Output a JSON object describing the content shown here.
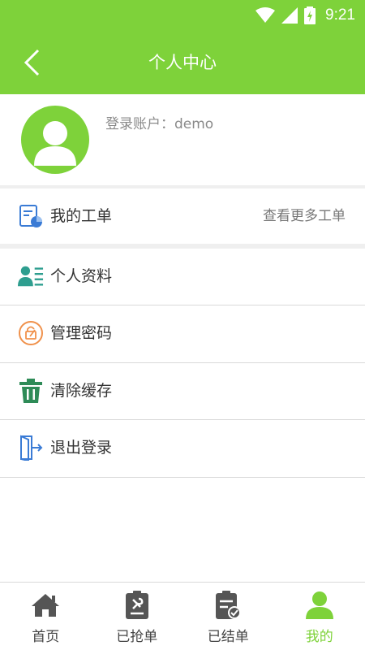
{
  "status_bar": {
    "time": "9:21"
  },
  "app_bar": {
    "title": "个人中心"
  },
  "profile": {
    "account_text": "登录账户：demo"
  },
  "work_orders": {
    "label": "我的工单",
    "more_link": "查看更多工单"
  },
  "menu": [
    {
      "label": "个人资料",
      "icon": "person-card-icon"
    },
    {
      "label": "管理密码",
      "icon": "password-edit-icon"
    },
    {
      "label": "清除缓存",
      "icon": "trash-icon"
    },
    {
      "label": "退出登录",
      "icon": "logout-icon"
    }
  ],
  "bottom_nav": [
    {
      "label": "首页",
      "icon": "home-icon",
      "active": false
    },
    {
      "label": "已抢单",
      "icon": "clipboard-wrench-icon",
      "active": false
    },
    {
      "label": "已结单",
      "icon": "clipboard-check-icon",
      "active": false
    },
    {
      "label": "我的",
      "icon": "person-icon",
      "active": true
    }
  ],
  "colors": {
    "primary": "#7ed23a",
    "text": "#333333",
    "muted": "#8a8a8a",
    "divider": "#d9d9d9"
  }
}
